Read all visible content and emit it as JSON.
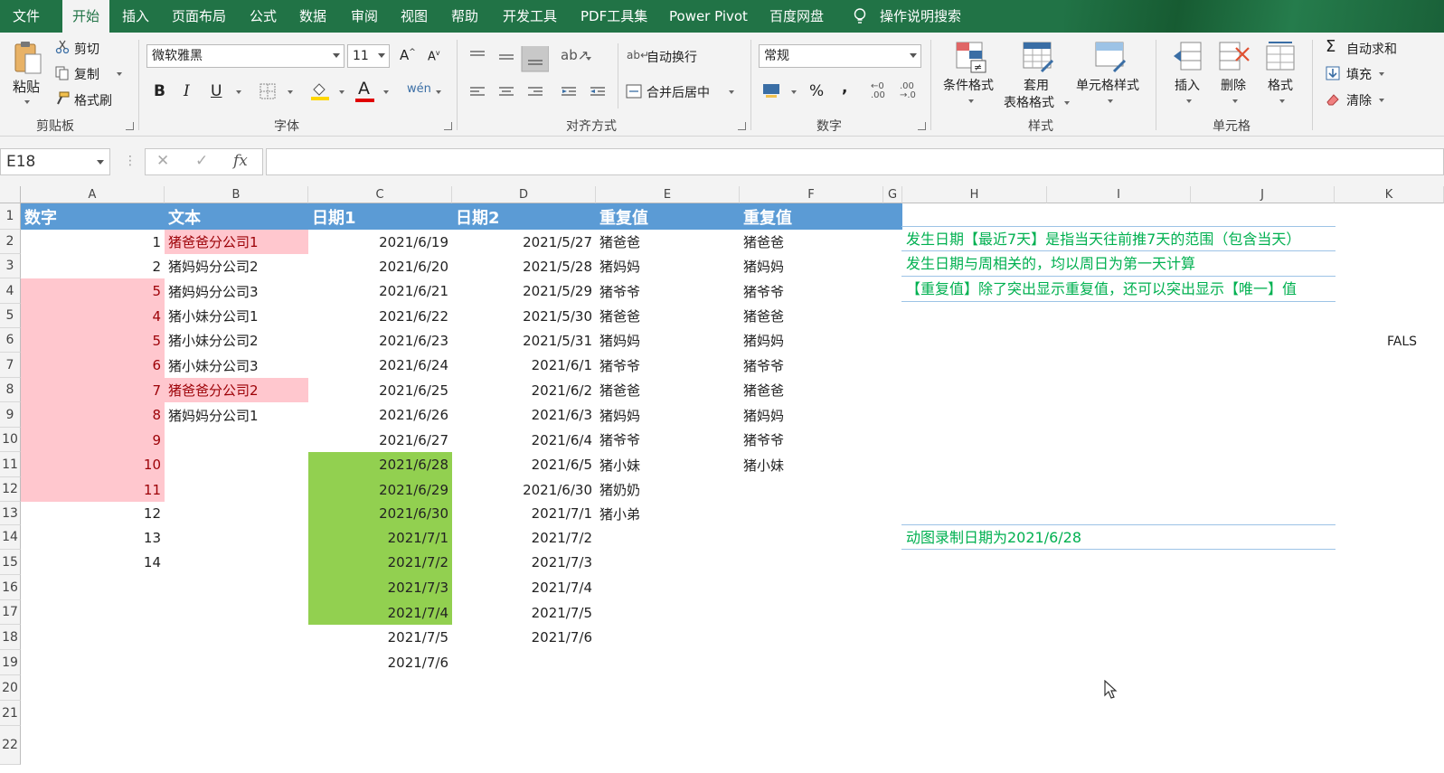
{
  "menu": {
    "tabs": [
      "文件",
      "开始",
      "插入",
      "页面布局",
      "公式",
      "数据",
      "审阅",
      "视图",
      "帮助",
      "开发工具",
      "PDF工具集",
      "Power Pivot",
      "百度网盘"
    ],
    "active_tab": "开始",
    "search_label": "操作说明搜索"
  },
  "ribbon": {
    "clipboard": {
      "paste": "粘贴",
      "cut": "剪切",
      "copy": "复制",
      "format_painter": "格式刷",
      "group_label": "剪贴板"
    },
    "font": {
      "font_name": "微软雅黑",
      "font_size": "11",
      "bold": "B",
      "italic": "I",
      "underline": "U",
      "group_label": "字体"
    },
    "alignment": {
      "wrap_text": "自动换行",
      "merge_center": "合并后居中",
      "group_label": "对齐方式"
    },
    "number": {
      "format": "常规",
      "percent": "%",
      "comma": ",",
      "group_label": "数字"
    },
    "styles": {
      "conditional": "条件格式",
      "table_format_1": "套用",
      "table_format_2": "表格格式",
      "cell_styles": "单元格样式",
      "group_label": "样式"
    },
    "cells": {
      "insert": "插入",
      "delete": "删除",
      "format": "格式",
      "group_label": "单元格"
    },
    "editing": {
      "autosum": "自动求和",
      "fill": "填充",
      "clear": "清除"
    }
  },
  "formula_bar": {
    "name_box": "E18",
    "cancel": "✕",
    "enter": "✓",
    "fx": "fx",
    "value": ""
  },
  "columns": [
    "A",
    "B",
    "C",
    "D",
    "E",
    "F",
    "G",
    "H",
    "I",
    "J",
    "K"
  ],
  "rows": [
    "1",
    "2",
    "3",
    "4",
    "5",
    "6",
    "7",
    "8",
    "9",
    "10",
    "11",
    "12",
    "13",
    "14",
    "15",
    "16",
    "17",
    "18",
    "19",
    "20",
    "21",
    "22"
  ],
  "headers": {
    "A": "数字",
    "B": "文本",
    "C": "日期1",
    "D": "日期2",
    "E": "重复值",
    "F": "重复值"
  },
  "col_a": [
    "1",
    "2",
    "5",
    "4",
    "5",
    "6",
    "7",
    "8",
    "9",
    "10",
    "11",
    "12",
    "13",
    "14"
  ],
  "col_a_highlight": [
    false,
    false,
    true,
    true,
    true,
    true,
    true,
    true,
    true,
    true,
    true,
    false,
    false,
    false
  ],
  "col_b": [
    "猪爸爸分公司1",
    "猪妈妈分公司2",
    "猪妈妈分公司3",
    "猪小妹分公司1",
    "猪小妹分公司2",
    "猪小妹分公司3",
    "猪爸爸分公司2",
    "猪妈妈分公司1"
  ],
  "col_b_highlight": [
    true,
    false,
    false,
    false,
    false,
    false,
    true,
    false
  ],
  "col_c": [
    "2021/6/19",
    "2021/6/20",
    "2021/6/21",
    "2021/6/22",
    "2021/6/23",
    "2021/6/24",
    "2021/6/25",
    "2021/6/26",
    "2021/6/27",
    "2021/6/28",
    "2021/6/29",
    "2021/6/30",
    "2021/7/1",
    "2021/7/2",
    "2021/7/3",
    "2021/7/4",
    "2021/7/5",
    "2021/7/6"
  ],
  "col_c_highlight": [
    false,
    false,
    false,
    false,
    false,
    false,
    false,
    false,
    false,
    true,
    true,
    true,
    true,
    true,
    true,
    true,
    false,
    false
  ],
  "col_d": [
    "2021/5/27",
    "2021/5/28",
    "2021/5/29",
    "2021/5/30",
    "2021/5/31",
    "2021/6/1",
    "2021/6/2",
    "2021/6/3",
    "2021/6/4",
    "2021/6/5",
    "2021/6/30",
    "2021/7/1",
    "2021/7/2",
    "2021/7/3",
    "2021/7/4",
    "2021/7/5",
    "2021/7/6"
  ],
  "col_e": [
    "猪爸爸",
    "猪妈妈",
    "猪爷爷",
    "猪爸爸",
    "猪妈妈",
    "猪爷爷",
    "猪爸爸",
    "猪妈妈",
    "猪爷爷",
    "猪小妹",
    "猪奶奶",
    "猪小弟"
  ],
  "col_f": [
    "猪爸爸",
    "猪妈妈",
    "猪爷爷",
    "猪爸爸",
    "猪妈妈",
    "猪爷爷",
    "猪爸爸",
    "猪妈妈",
    "猪爷爷",
    "猪小妹"
  ],
  "notes": [
    "发生日期【最近7天】是指当天往前推7天的范围（包含当天）",
    "发生日期与周相关的，均以周日为第一天计算",
    "【重复值】除了突出显示重复值，还可以突出显示【唯一】值",
    "动图录制日期为2021/6/28"
  ],
  "k6_value": "FALS",
  "colors": {
    "excel_green": "#217346",
    "header_blue": "#5b9bd5",
    "dup_pink": "#ffc7ce",
    "dup_text": "#9c0006",
    "date_green": "#92d050",
    "note_green": "#00b050"
  }
}
